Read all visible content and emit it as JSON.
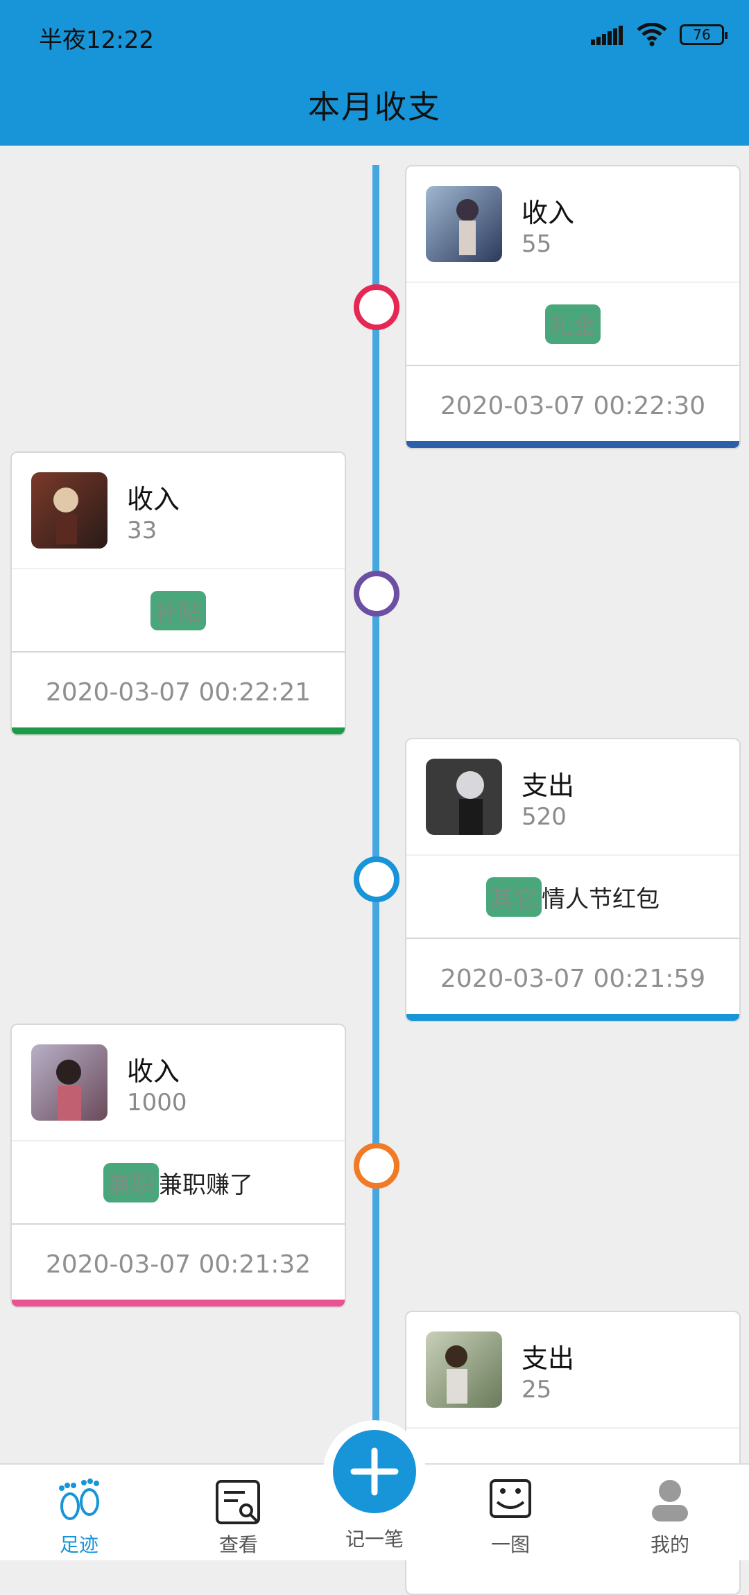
{
  "status": {
    "time": "半夜12:22",
    "battery": "76"
  },
  "header": {
    "title": "本月收支"
  },
  "colors": {
    "accent": "#1795d8",
    "line": "#44a7e0",
    "tag": "#4aa77c"
  },
  "entries": [
    {
      "type": "收入",
      "amount": "55",
      "tag": "礼金",
      "note": "",
      "time": "2020-03-07 00:22:30",
      "node_color": "#e52853",
      "bar_color": "#2d5ea8"
    },
    {
      "type": "收入",
      "amount": "33",
      "tag": "补贴",
      "note": "",
      "time": "2020-03-07 00:22:21",
      "node_color": "#6c4fa3",
      "bar_color": "#1c9a48"
    },
    {
      "type": "支出",
      "amount": "520",
      "tag": "其它",
      "note": "情人节红包",
      "time": "2020-03-07 00:21:59",
      "node_color": "#1795d8",
      "bar_color": "#1795d8"
    },
    {
      "type": "收入",
      "amount": "1000",
      "tag": "兼职",
      "note": "兼职赚了",
      "time": "2020-03-07 00:21:32",
      "node_color": "#f07a25",
      "bar_color": "#e85392"
    },
    {
      "type": "支出",
      "amount": "25",
      "tag": "",
      "note": "",
      "time": "",
      "node_color": "#1795d8",
      "bar_color": "#1795d8"
    }
  ],
  "bottom_nav": [
    {
      "label": "足迹",
      "icon": "footprint-icon"
    },
    {
      "label": "查看",
      "icon": "search-document-icon"
    },
    {
      "label": "记一笔",
      "icon": "plus-icon"
    },
    {
      "label": "一图",
      "icon": "image-icon"
    },
    {
      "label": "我的",
      "icon": "user-icon"
    }
  ]
}
